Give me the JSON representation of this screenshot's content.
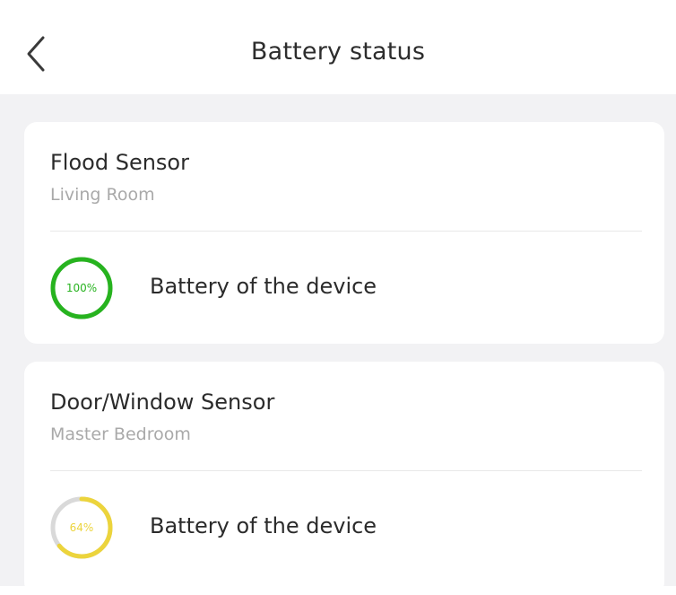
{
  "header": {
    "title": "Battery status",
    "back_icon": "chevron-left-icon"
  },
  "devices": [
    {
      "name": "Flood Sensor",
      "room": "Living Room",
      "battery_label": "100%",
      "battery_level": 1.0,
      "battery_color": "#27b31f",
      "battery_text": "Battery of the device"
    },
    {
      "name": "Door/Window Sensor",
      "room": "Master Bedroom",
      "battery_label": "64%",
      "battery_level": 0.64,
      "battery_color": "#ecd43c",
      "battery_text": "Battery of the device"
    }
  ],
  "colors": {
    "background": "#f2f2f4",
    "card": "#ffffff",
    "ring_track": "#d9d9d9"
  }
}
